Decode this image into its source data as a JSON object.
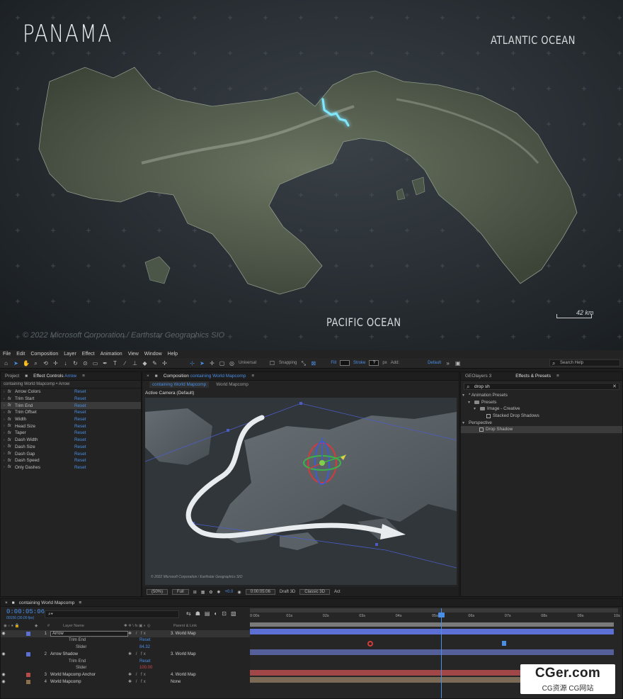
{
  "hero": {
    "title": "PANAMA",
    "atlantic": "ATLANTIC OCEAN",
    "pacific": "PACIFIC OCEAN",
    "copyright": "© 2022 Microsoft Corporation / Earthstar Geographics  SIO",
    "scale": "42 km"
  },
  "menu": [
    "File",
    "Edit",
    "Composition",
    "Layer",
    "Effect",
    "Animation",
    "View",
    "Window",
    "Help"
  ],
  "toolbar": {
    "universal": "Universal",
    "snapping": "Snapping",
    "fill": "Fill",
    "stroke": "Stroke",
    "stroke_value": "?",
    "px": "px",
    "add": "Add:",
    "workspace": "Default",
    "search_help": "Search Help"
  },
  "effect_controls": {
    "tab_project": "Project",
    "tab_effect": "Effect Controls",
    "tab_effect_target": "Arrow",
    "subtitle": "containing World Mapcomp • Arrow",
    "reset": "Reset",
    "items": [
      "Arrow Colors",
      "Trim Start",
      "Trim End",
      "Trim Offset",
      "Width",
      "Head Size",
      "Taper",
      "Dash Width",
      "Dash Size",
      "Dash Gap",
      "Dash Speed",
      "Only Dashes"
    ]
  },
  "composition": {
    "tab_label": "Composition",
    "tab_name": "containing World Mapcomp",
    "sub_active": "containing World Mapcomp",
    "sub_other": "World Mapcomp",
    "camera": "Active Camera (Default)",
    "copyright": "© 2022 Microsoft Corporation / Earthstar Geographics  SIO",
    "zoom": "(50%)",
    "quality": "Full",
    "exposure": "+0.0",
    "timecode": "0:00:05:06",
    "draft": "Draft 3D",
    "renderer": "Classic 3D",
    "act": "Act"
  },
  "effects_presets": {
    "tab_geo": "GEOlayers 3",
    "tab_ep": "Effects & Presets",
    "search": "drop sh",
    "rows": [
      {
        "label": "* Animation Presets",
        "indent": 2,
        "kind": "chev"
      },
      {
        "label": "Presets",
        "indent": 10,
        "kind": "folder"
      },
      {
        "label": "Image - Creative",
        "indent": 18,
        "kind": "folder"
      },
      {
        "label": "Stacked Drop Shadows",
        "indent": 36,
        "kind": "preset"
      },
      {
        "label": "Perspective",
        "indent": 2,
        "kind": "chev"
      },
      {
        "label": "Drop Shadow",
        "indent": 26,
        "kind": "preset",
        "selected": true
      }
    ]
  },
  "timeline": {
    "tab": "containing World Mapcomp",
    "time": "0:00:05:06",
    "fps": "00156 (30.00 fps)",
    "search_placeholder": "⌕▾",
    "col_layer": "Layer Name",
    "col_parent": "Parent & Link",
    "ruler": [
      "0:00s",
      "01s",
      "02s",
      "03s",
      "04s",
      "05s",
      "06s",
      "07s",
      "08s",
      "09s",
      "10s"
    ],
    "layers": [
      {
        "num": "1",
        "name": "Arrow",
        "parent": "3. World Map",
        "chip": "#5b6fd4",
        "selected": true
      },
      {
        "num": "",
        "name": "Trim End",
        "value": "Reset",
        "sub": true
      },
      {
        "num": "",
        "name": "Slider",
        "value": "84.32",
        "sub": true,
        "deep": true
      },
      {
        "num": "2",
        "name": "Arrow Shadow",
        "parent": "3. World Map",
        "chip": "#5b6fd4"
      },
      {
        "num": "",
        "name": "Trim End",
        "value": "Reset",
        "sub": true
      },
      {
        "num": "",
        "name": "Slider",
        "value": "100.00",
        "sub": true,
        "deep": true,
        "red": true
      },
      {
        "num": "3",
        "name": "World Mapcomp Anchor",
        "parent": "4. World Map",
        "chip": "#b84a4a"
      },
      {
        "num": "4",
        "name": "World Mapcomp",
        "parent": "None",
        "chip": "#8a6f4a"
      }
    ]
  },
  "watermark": {
    "main": "CGer.com",
    "sub": "CG资源 CG网站"
  },
  "colors": {
    "accent": "#4a8fe7",
    "glow": "#7fe8ff"
  }
}
